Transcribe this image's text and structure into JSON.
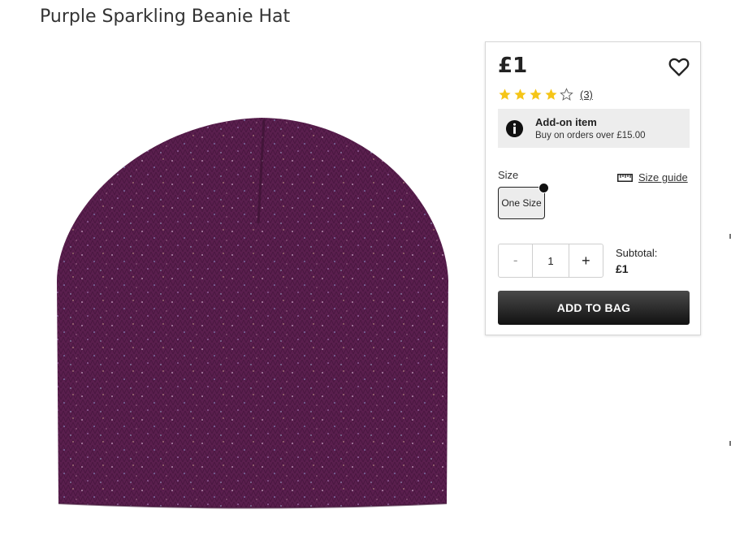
{
  "product": {
    "title": "Purple Sparkling Beanie Hat"
  },
  "buybox": {
    "price": "£1",
    "rating": {
      "stars": 4,
      "max": 5,
      "reviews_label": "(3)"
    },
    "addon": {
      "title": "Add-on item",
      "subtitle": "Buy on orders over £15.00"
    },
    "size": {
      "label": "Size",
      "guide_label": "Size guide",
      "selected": "One Size"
    },
    "quantity": {
      "decrement": "-",
      "value": "1",
      "increment": "+"
    },
    "subtotal": {
      "label": "Subtotal:",
      "value": "£1"
    },
    "add_button": "ADD TO BAG"
  },
  "icons": {
    "wishlist": "heart-icon",
    "addon": "info-icon",
    "size_guide": "ruler-icon",
    "selected": "check-icon"
  },
  "colors": {
    "star": "#f5c518",
    "hat": "#5a1f4e",
    "button": "#1a1a1a"
  }
}
